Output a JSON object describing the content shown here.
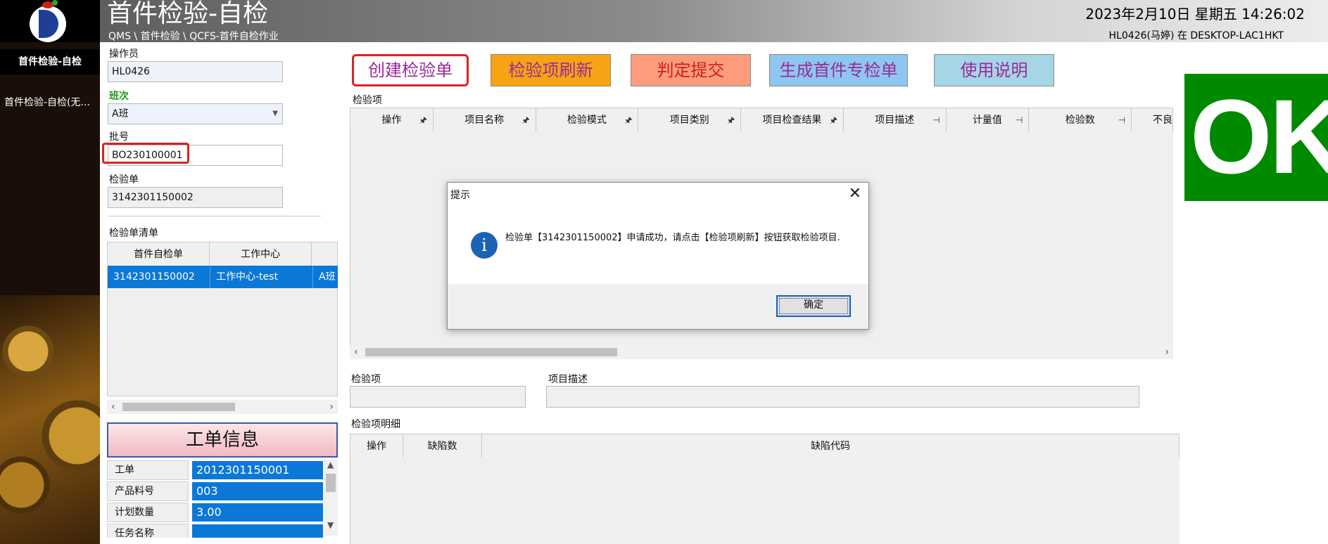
{
  "header": {
    "title": "首件检验-自检",
    "breadcrumb": "QMS \\ 首件检验 \\ QCFS-首件自检作业",
    "datetime": "2023年2月10日 星期五 14:26:02",
    "user_host": "HL0426(马婷) 在 DESKTOP-LAC1HKT"
  },
  "nav": {
    "items": [
      {
        "label": "首件检验-自检"
      },
      {
        "label": "首件检验-自检(无..."
      }
    ]
  },
  "form": {
    "operator_label": "操作员",
    "operator_value": "HL0426",
    "shift_label": "班次",
    "shift_value": "A班",
    "batch_label": "批号",
    "batch_value": "BO230100001",
    "inspection_label": "检验单",
    "inspection_value": "3142301150002"
  },
  "inspection_list": {
    "title": "检验单清单",
    "columns": [
      "首件自检单",
      "工作中心",
      ""
    ],
    "rows": [
      [
        "3142301150002",
        "工作中心-test",
        "A班"
      ]
    ]
  },
  "work_order": {
    "title": "工单信息",
    "rows": [
      {
        "key": "工单",
        "value": "2012301150001"
      },
      {
        "key": "产品料号",
        "value": "003"
      },
      {
        "key": "计划数量",
        "value": "3.00"
      },
      {
        "key": "任务名称",
        "value": ""
      }
    ]
  },
  "toolbar": {
    "create": "创建检验单",
    "refresh": "检验项刷新",
    "submit": "判定提交",
    "generate": "生成首件专检单",
    "help": "使用说明"
  },
  "inspection_items": {
    "title": "检验项",
    "columns": [
      "操作",
      "项目名称",
      "检验模式",
      "项目类别",
      "项目检查结果",
      "项目描述",
      "计量值",
      "检验数",
      "不良"
    ]
  },
  "ok_panel": {
    "text": "OK",
    "color": "#008a00"
  },
  "bottom": {
    "item_label": "检验项",
    "desc_label": "项目描述"
  },
  "detail": {
    "title": "检验项明细",
    "columns": [
      "操作",
      "缺陷数",
      "缺陷代码"
    ]
  },
  "dialog": {
    "title": "提示",
    "message": "检验单【3142301150002】申请成功，请点击【检验项刷新】按钮获取检验项目.",
    "ok_label": "确定",
    "icon": "info-icon"
  },
  "colors": {
    "selection": "#0b78d7",
    "highlight_border": "#e02020"
  }
}
